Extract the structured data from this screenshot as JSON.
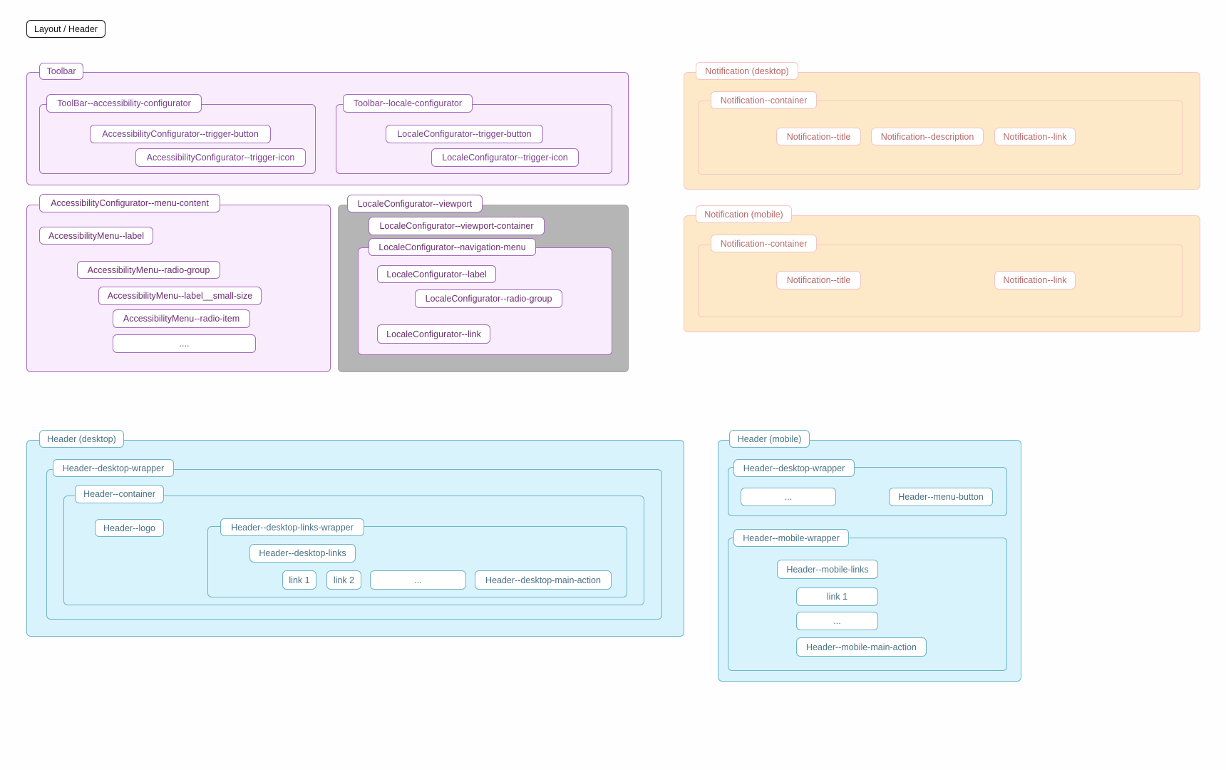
{
  "page_title": "Layout / Header",
  "colors": {
    "toolbar_fill": "#f9ecfc",
    "toolbar_stroke": "#a56bc0",
    "viewport_fill": "#b5b5b5",
    "notification_fill": "#fde9c8",
    "notification_stroke": "#f7c6c2",
    "header_fill": "#d9f3fc",
    "header_stroke": "#6eb4c8"
  },
  "toolbar": {
    "label": "Toolbar",
    "accessibility_configurator": {
      "label": "ToolBar--accessibility-configurator",
      "trigger_button": "AccessibilityConfigurator--trigger-button",
      "trigger_icon": "AccessibilityConfigurator--trigger-icon"
    },
    "locale_configurator": {
      "label": "Toolbar--locale-configurator",
      "trigger_button": "LocaleConfigurator--trigger-button",
      "trigger_icon": "LocaleConfigurator--trigger-icon"
    }
  },
  "accessibility_menu": {
    "label": "AccessibilityConfigurator--menu-content",
    "menu_label": "AccessibilityMenu--label",
    "radio_group": "AccessibilityMenu--radio-group",
    "label_small_size": "AccessibilityMenu--label__small-size",
    "radio_item": "AccessibilityMenu--radio-item",
    "more": "...."
  },
  "locale_viewport": {
    "label": "LocaleConfigurator--viewport",
    "viewport_container": "LocaleConfigurator--viewport-container",
    "navigation_menu": {
      "label": "LocaleConfigurator--navigation-menu",
      "menu_label": "LocaleConfigurator--label",
      "radio_group": "LocaleConfigurator--radio-group",
      "link": "LocaleConfigurator--link"
    }
  },
  "notification_desktop": {
    "label": "Notification (desktop)",
    "container": "Notification--container",
    "title": "Notification--title",
    "description": "Notification--description",
    "link": "Notification--link"
  },
  "notification_mobile": {
    "label": "Notification (mobile)",
    "container": "Notification--container",
    "title": "Notification--title",
    "link": "Notification--link"
  },
  "header_desktop": {
    "label": "Header (desktop)",
    "desktop_wrapper": "Header--desktop-wrapper",
    "container": "Header--container",
    "logo": "Header--logo",
    "links_wrapper": "Header--desktop-links-wrapper",
    "links": "Header--desktop-links",
    "link_items": [
      "link 1",
      "link 2",
      "..."
    ],
    "main_action": "Header--desktop-main-action"
  },
  "header_mobile": {
    "label": "Header (mobile)",
    "desktop_wrapper": "Header--desktop-wrapper",
    "placeholder": "...",
    "menu_button": "Header--menu-button",
    "mobile_wrapper": "Header--mobile-wrapper",
    "mobile_links": "Header--mobile-links",
    "link_items": [
      "link 1",
      "..."
    ],
    "main_action": "Header--mobile-main-action"
  }
}
